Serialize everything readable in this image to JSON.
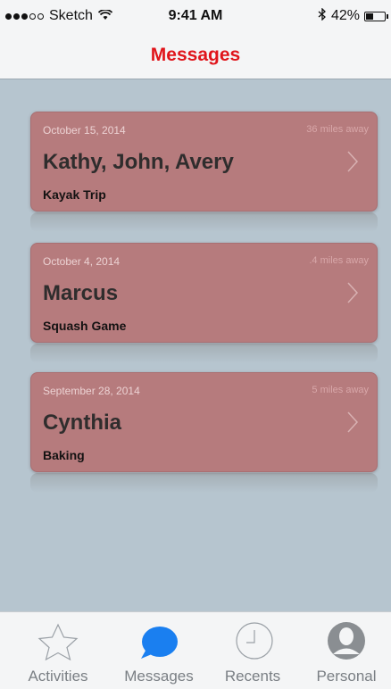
{
  "status_bar": {
    "signal_dots_filled": 3,
    "signal_dots_total": 5,
    "carrier": "Sketch",
    "time": "9:41 AM",
    "battery_label": "42%",
    "battery_level": 0.42
  },
  "nav": {
    "title": "Messages"
  },
  "messages": [
    {
      "date": "October 15, 2014",
      "distance": "36  miles away",
      "names": "Kathy, John, Avery",
      "event": "Kayak Trip"
    },
    {
      "date": "October 4, 2014",
      "distance": ".4  miles away",
      "names": "Marcus",
      "event": "Squash Game"
    },
    {
      "date": "September 28, 2014",
      "distance": "5  miles away",
      "names": "Cynthia",
      "event": "Baking"
    }
  ],
  "tabs": [
    {
      "label": "Activities",
      "icon": "star-icon"
    },
    {
      "label": "Messages",
      "icon": "chat-bubble-icon",
      "active": true
    },
    {
      "label": "Recents",
      "icon": "clock-icon"
    },
    {
      "label": "Personal",
      "icon": "person-icon"
    }
  ],
  "colors": {
    "accent": "#e0151b",
    "active_tab": "#1a7ff0",
    "card": "#b67b7d",
    "background": "#b6c5cf"
  }
}
